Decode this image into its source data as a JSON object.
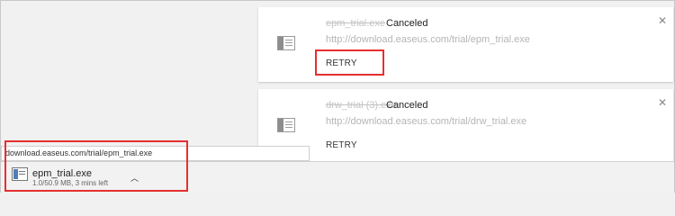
{
  "downloads": [
    {
      "name": "epm_trial.exe",
      "status": "Canceled",
      "url": "http://download.easeus.com/trial/epm_trial.exe",
      "action": "RETRY"
    },
    {
      "name": "drw_trial (3).exe",
      "status": "Canceled",
      "url": "http://download.easeus.com/trial/drw_trial.exe",
      "action": "RETRY"
    }
  ],
  "shelf": {
    "tooltip": "download.easeus.com/trial/epm_trial.exe",
    "file_name": "epm_trial.exe",
    "progress": "1.0/50.9 MB, 3 mins left"
  },
  "icons": {
    "close": "close-icon",
    "file": "file-icon",
    "chevron": "chevron-up-icon"
  },
  "colors": {
    "highlight": "#e62f2f"
  }
}
